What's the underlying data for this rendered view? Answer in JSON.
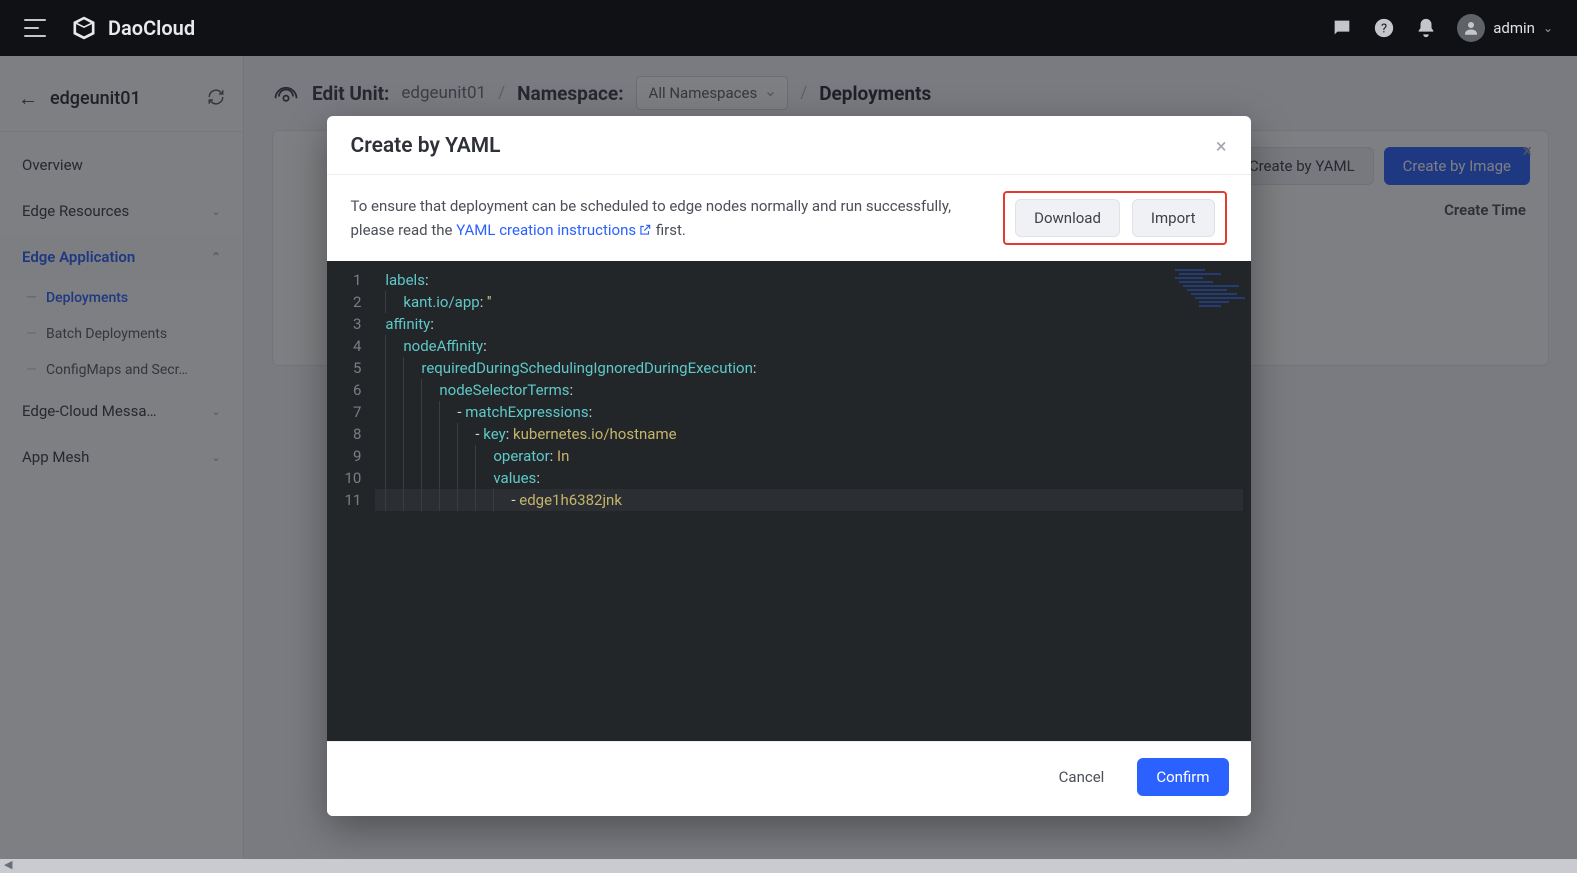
{
  "brand": "DaoCloud",
  "user": "admin",
  "context": {
    "title": "edgeunit01"
  },
  "sidebar": {
    "items": [
      {
        "label": "Overview"
      },
      {
        "label": "Edge Resources"
      },
      {
        "label": "Edge Application"
      },
      {
        "label": "Edge-Cloud Messa…"
      },
      {
        "label": "App Mesh"
      }
    ],
    "sub": [
      {
        "label": "Deployments"
      },
      {
        "label": "Batch Deployments"
      },
      {
        "label": "ConfigMaps and Secr…"
      }
    ]
  },
  "breadcrumb": {
    "edit_label": "Edit Unit:",
    "edit_value": "edgeunit01",
    "ns_label": "Namespace:",
    "ns_value": "All Namespaces",
    "page": "Deployments"
  },
  "panel": {
    "create_yaml": "Create by YAML",
    "create_image": "Create by Image",
    "col_create_time": "Create Time"
  },
  "modal": {
    "title": "Create by YAML",
    "info1": "To ensure that deployment can be scheduled to edge nodes normally and run successfully, please read the ",
    "info_link": "YAML creation instructions",
    "info2": " first.",
    "download": "Download",
    "import": "Import",
    "cancel": "Cancel",
    "confirm": "Confirm"
  },
  "yaml": {
    "lines": [
      [
        {
          "t": "key",
          "v": "labels"
        },
        {
          "t": "col",
          "v": ":"
        }
      ],
      [
        {
          "t": "ind",
          "v": 1
        },
        {
          "t": "key",
          "v": "kant.io/app"
        },
        {
          "t": "col",
          "v": ": "
        },
        {
          "t": "str",
          "v": "''"
        }
      ],
      [
        {
          "t": "key",
          "v": "affinity"
        },
        {
          "t": "col",
          "v": ":"
        }
      ],
      [
        {
          "t": "ind",
          "v": 1
        },
        {
          "t": "key",
          "v": "nodeAffinity"
        },
        {
          "t": "col",
          "v": ":"
        }
      ],
      [
        {
          "t": "ind",
          "v": 2
        },
        {
          "t": "key",
          "v": "requiredDuringSchedulingIgnoredDuringExecution"
        },
        {
          "t": "col",
          "v": ":"
        }
      ],
      [
        {
          "t": "ind",
          "v": 3
        },
        {
          "t": "key",
          "v": "nodeSelectorTerms"
        },
        {
          "t": "col",
          "v": ":"
        }
      ],
      [
        {
          "t": "ind",
          "v": 4
        },
        {
          "t": "dash",
          "v": "- "
        },
        {
          "t": "key",
          "v": "matchExpressions"
        },
        {
          "t": "col",
          "v": ":"
        }
      ],
      [
        {
          "t": "ind",
          "v": 5
        },
        {
          "t": "dash",
          "v": "- "
        },
        {
          "t": "key",
          "v": "key"
        },
        {
          "t": "col",
          "v": ": "
        },
        {
          "t": "val",
          "v": "kubernetes.io/hostname"
        }
      ],
      [
        {
          "t": "ind",
          "v": 6
        },
        {
          "t": "key",
          "v": "operator"
        },
        {
          "t": "col",
          "v": ": "
        },
        {
          "t": "val",
          "v": "In"
        }
      ],
      [
        {
          "t": "ind",
          "v": 6
        },
        {
          "t": "key",
          "v": "values"
        },
        {
          "t": "col",
          "v": ":"
        }
      ],
      [
        {
          "t": "ind",
          "v": 7
        },
        {
          "t": "dash",
          "v": "- "
        },
        {
          "t": "val",
          "v": "edge1h6382jnk"
        }
      ]
    ]
  }
}
